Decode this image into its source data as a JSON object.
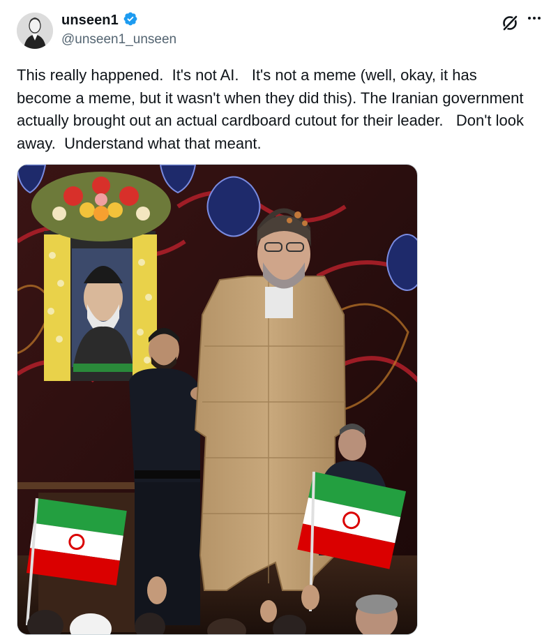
{
  "post": {
    "author": {
      "display_name": "unseen1",
      "handle": "@unseen1_unseen",
      "verified": true,
      "avatar": "portrait-avatar"
    },
    "text": "This really happened.  It's not AI.   It's not a meme (well, okay, it has become a meme, but it wasn't when they did this). The Iranian government actually brought out an actual cardboard cutout for their leader.   Don't look away.  Understand what that meant.",
    "icons": {
      "grok": "grok-icon",
      "more": "more-options-icon",
      "verified": "verified-badge-icon"
    }
  },
  "colors": {
    "verified_blue": "#1d9bf0",
    "text": "#0f1419",
    "secondary": "#536471"
  }
}
